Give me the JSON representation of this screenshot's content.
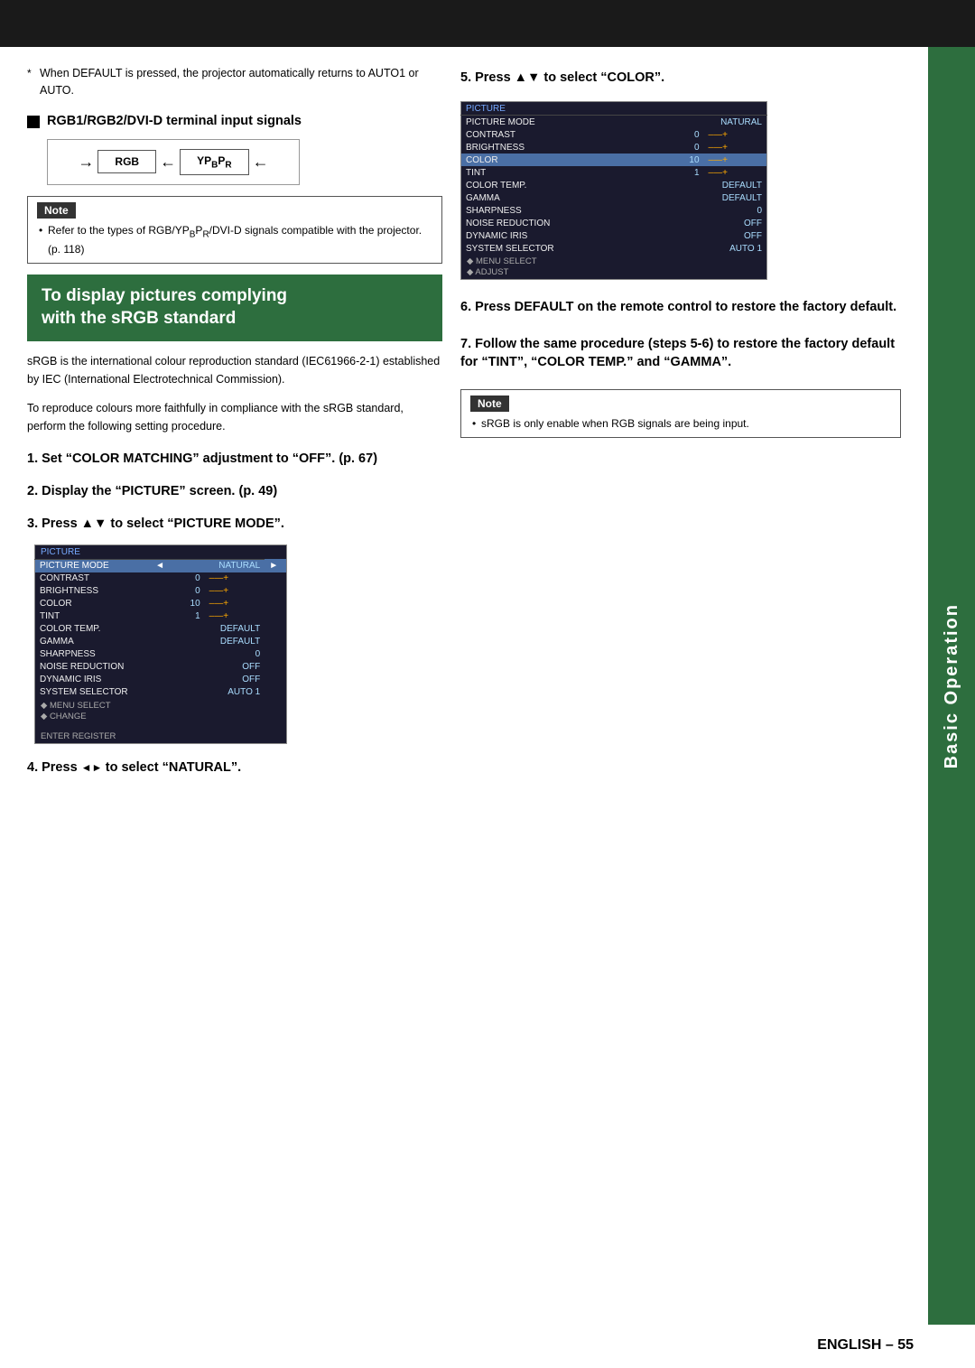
{
  "topBar": {},
  "sidebar": {
    "label": "Basic Operation"
  },
  "topNote": {
    "text": "When DEFAULT is pressed, the projector automatically returns to AUTO1 or AUTO."
  },
  "section1": {
    "heading": "RGB1/RGB2/DVI-D terminal input signals",
    "diagramLeft": "RGB",
    "diagramRight": "YPBPR"
  },
  "noteBox1": {
    "title": "Note",
    "text": "Refer to the types of RGB/YPBPR/DVI-D signals compatible with the projector. (p. 118)"
  },
  "highlightBox": {
    "line1": "To display pictures complying",
    "line2": "with the sRGB standard"
  },
  "bodyText": [
    "sRGB is the international colour reproduction standard (IEC61966-2-1) established by IEC (International Electrotechnical Commission).",
    "To reproduce colours more faithfully in compliance with the sRGB standard, perform the following setting procedure."
  ],
  "steps": {
    "step1": "1. Set “COLOR MATCHING” adjustment to “OFF”. (p. 67)",
    "step2": "2. Display the “PICTURE” screen. (p. 49)",
    "step3": "3. Press ▲▼ to select “PICTURE MODE”.",
    "step4_prefix": "4. Press",
    "step4_suffix": "to select “NATURAL”.",
    "step5": "5. Press ▲▼ to select “COLOR”.",
    "step6": "6. Press DEFAULT on the remote control to restore the factory default.",
    "step7": "7. Follow the same procedure (steps 5-6) to restore the factory default for “TINT”, “COLOR TEMP.” and “GAMMA”."
  },
  "pictureTableLeft": {
    "header": "PICTURE",
    "rows": [
      {
        "label": "PICTURE MODE",
        "val": "NATURAL",
        "arrow": true
      },
      {
        "label": "CONTRAST",
        "val": "0",
        "bar": "–—+",
        "highlight": false
      },
      {
        "label": "BRIGHTNESS",
        "val": "0",
        "bar": "–—+",
        "highlight": false
      },
      {
        "label": "COLOR",
        "val": "10",
        "bar": "–—+",
        "highlight": false
      },
      {
        "label": "TINT",
        "val": "1",
        "bar": "–—+",
        "highlight": false
      },
      {
        "label": "COLOR TEMP.",
        "val": "DEFAULT",
        "highlight": false
      },
      {
        "label": "GAMMA",
        "val": "DEFAULT",
        "highlight": false
      },
      {
        "label": "SHARPNESS",
        "val": "0",
        "highlight": false
      },
      {
        "label": "NOISE REDUCTION",
        "val": "OFF",
        "highlight": false
      },
      {
        "label": "DYNAMIC IRIS",
        "val": "OFF",
        "highlight": false
      },
      {
        "label": "SYSTEM SELECTOR",
        "val": "AUTO 1",
        "highlight": false
      }
    ],
    "footer1": "◆ MENU SELECT",
    "footer2": "◆ CHANGE",
    "footer3": "ENTER REGISTER"
  },
  "pictureTableRight": {
    "header": "PICTURE",
    "rows": [
      {
        "label": "PICTURE MODE",
        "val": "NATURAL",
        "arrow": false
      },
      {
        "label": "CONTRAST",
        "val": "0",
        "bar": "–—+",
        "highlight": false
      },
      {
        "label": "BRIGHTNESS",
        "val": "0",
        "bar": "–—+",
        "highlight": false
      },
      {
        "label": "COLOR",
        "val": "10",
        "bar": "–—+",
        "highlight": true
      },
      {
        "label": "TINT",
        "val": "1",
        "bar": "–—+",
        "highlight": false
      },
      {
        "label": "COLOR TEMP.",
        "val": "DEFAULT",
        "highlight": false
      },
      {
        "label": "GAMMA",
        "val": "DEFAULT",
        "highlight": false
      },
      {
        "label": "SHARPNESS",
        "val": "0",
        "highlight": false
      },
      {
        "label": "NOISE REDUCTION",
        "val": "OFF",
        "highlight": false
      },
      {
        "label": "DYNAMIC IRIS",
        "val": "OFF",
        "highlight": false
      },
      {
        "label": "SYSTEM SELECTOR",
        "val": "AUTO 1",
        "highlight": false
      }
    ],
    "footer1": "◆ MENU SELECT",
    "footer2": "◆ ADJUST"
  },
  "noteBoxRight": {
    "title": "Note",
    "text": "sRGB is only enable when RGB signals are being input."
  },
  "bottomLabel": "ENGLISH – 55"
}
